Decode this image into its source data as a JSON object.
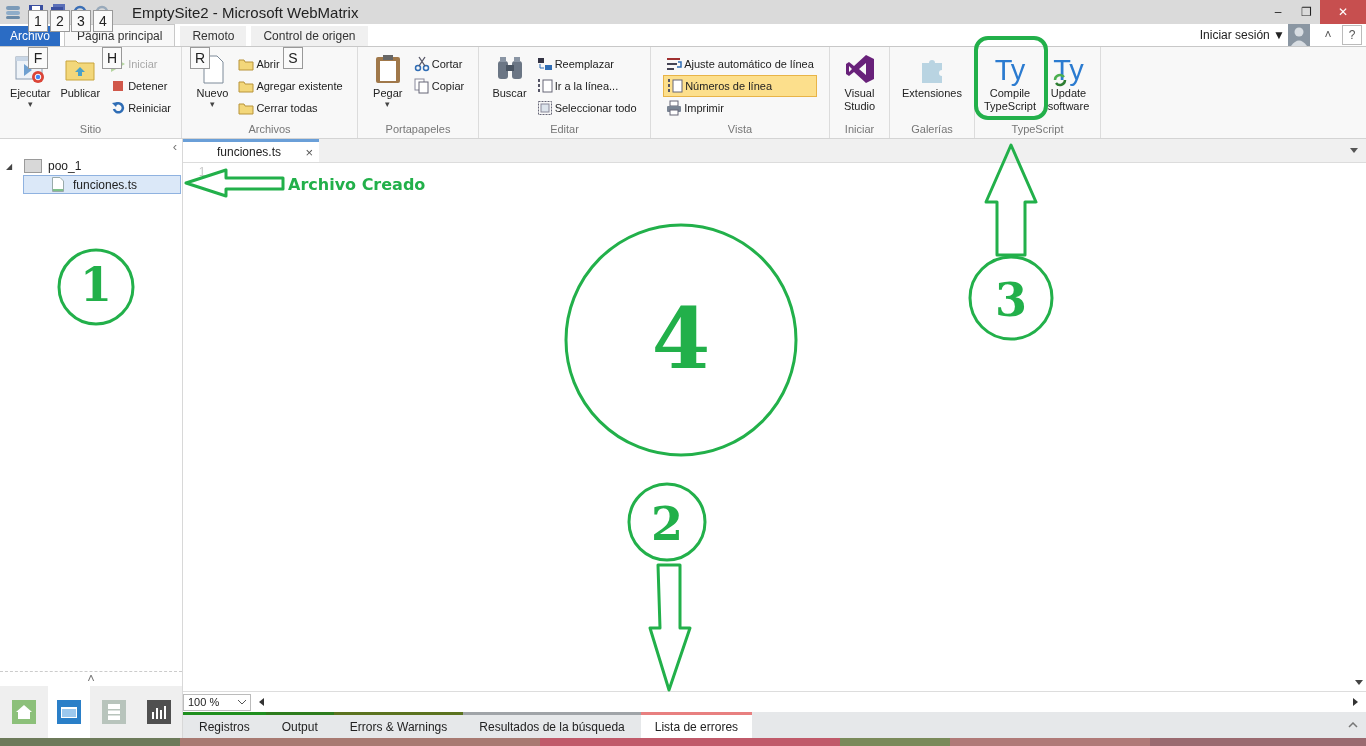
{
  "window": {
    "title": "EmptySite2 - Microsoft WebMatrix",
    "minimize": "–",
    "restore": "❐",
    "close": "✕"
  },
  "key_tips": [
    "1",
    "2",
    "3",
    "4",
    "F",
    "H",
    "R",
    "S"
  ],
  "ribbon_tabs": [
    {
      "label": "Archivo",
      "kind": "file",
      "selected": false
    },
    {
      "label": "Página principal",
      "kind": "tab",
      "selected": true
    },
    {
      "label": "Remoto",
      "kind": "tab",
      "selected": false
    },
    {
      "label": "Control de origen",
      "kind": "tab",
      "selected": false
    }
  ],
  "account": {
    "label": "Iniciar sesión",
    "caret": "▼",
    "collapse": "˄",
    "help": "?"
  },
  "ribbon_groups": [
    {
      "label": "Sitio",
      "large": [
        {
          "label": "Ejecutar",
          "dropdown": "▾"
        },
        {
          "label": "Publicar"
        }
      ],
      "small": [
        {
          "label": "Iniciar",
          "disabled": true,
          "checked": false
        },
        {
          "label": "Detener",
          "disabled": false,
          "checked": false
        },
        {
          "label": "Reiniciar",
          "disabled": false,
          "checked": false
        }
      ]
    },
    {
      "label": "Archivos",
      "large": [
        {
          "label": "Nuevo",
          "dropdown": "▾"
        }
      ],
      "small": [
        {
          "label": "Abrir",
          "disabled": false,
          "checked": false
        },
        {
          "label": "Agregar existente",
          "disabled": false,
          "checked": false
        },
        {
          "label": "Cerrar todas",
          "disabled": false,
          "checked": false
        }
      ]
    },
    {
      "label": "Portapapeles",
      "large": [
        {
          "label": "Pegar",
          "dropdown": "▾"
        }
      ],
      "small": [
        {
          "label": "Cortar",
          "disabled": false,
          "checked": false
        },
        {
          "label": "Copiar",
          "disabled": false,
          "checked": false
        }
      ]
    },
    {
      "label": "Editar",
      "large": [
        {
          "label": "Buscar"
        }
      ],
      "small": [
        {
          "label": "Reemplazar",
          "disabled": false,
          "checked": false
        },
        {
          "label": "Ir a la línea...",
          "disabled": false,
          "checked": false
        },
        {
          "label": "Seleccionar todo",
          "disabled": false,
          "checked": false
        }
      ]
    },
    {
      "label": "Vista",
      "small": [
        {
          "label": "Ajuste automático de línea",
          "disabled": false,
          "checked": false
        },
        {
          "label": "Números de línea",
          "disabled": false,
          "checked": true
        },
        {
          "label": "Imprimir",
          "disabled": false,
          "checked": false
        }
      ]
    },
    {
      "label": "Iniciar",
      "large": [
        {
          "label": "Visual Studio"
        }
      ]
    },
    {
      "label": "Galerías",
      "large": [
        {
          "label": "Extensiones"
        }
      ]
    },
    {
      "label": "TypeScript",
      "large": [
        {
          "label": "Compile TypeScript",
          "icon_text": "Ty"
        },
        {
          "label": "Update software",
          "icon_text": "Ty"
        }
      ]
    }
  ],
  "sidebar": {
    "collapse": "‹",
    "expand": "˄",
    "tree": [
      {
        "label": "poo_1",
        "expander": "◢",
        "expanded": true,
        "children": [
          {
            "label": "funciones.ts",
            "selected": true
          }
        ]
      }
    ],
    "views": [
      {
        "selected": false
      },
      {
        "selected": true
      },
      {
        "selected": false
      },
      {
        "selected": false
      }
    ]
  },
  "editor": {
    "tabs": [
      {
        "label": "funciones.ts",
        "close": "×",
        "selected": true
      }
    ],
    "line_numbers": [
      "1"
    ],
    "zoom": "100 %"
  },
  "bottom_tabs": [
    {
      "label": "Registros",
      "color": "#1f8f1f",
      "selected": false
    },
    {
      "label": "Output",
      "color": "#2e7d1e",
      "selected": false
    },
    {
      "label": "Errors & Warnings",
      "color": "#5b7320",
      "selected": false
    },
    {
      "label": "Resultados de la búsqueda",
      "color": "#a0a4a8",
      "selected": false
    },
    {
      "label": "Lista de errores",
      "color": "#e88080",
      "selected": true
    }
  ],
  "annotations": {
    "callout": "Archivo Creado",
    "numbers": [
      "1",
      "4",
      "3",
      "2"
    ]
  }
}
